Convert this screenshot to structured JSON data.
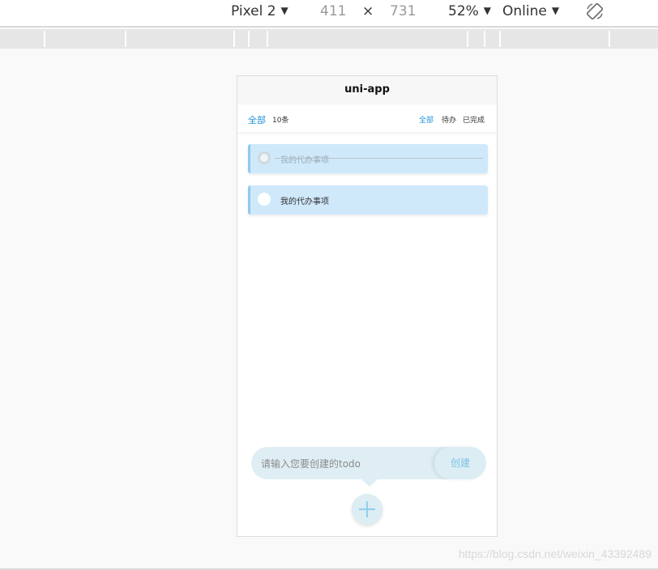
{
  "devtools": {
    "device": "Pixel 2",
    "width": "411",
    "times": "×",
    "height": "731",
    "zoom": "52%",
    "network": "Online",
    "caret": "▼"
  },
  "app": {
    "title": "uni-app",
    "filter": {
      "left_all": "全部",
      "count": "10条",
      "options": [
        "全部",
        "待办",
        "已完成"
      ],
      "active_index": 0
    },
    "todos": [
      {
        "text": "我的代办事项",
        "done": true
      },
      {
        "text": "我的代办事项",
        "done": false
      }
    ],
    "input": {
      "placeholder": "请输入您要创建的todo",
      "button_label": "创建"
    }
  },
  "watermark": "https://blog.csdn.net/weixin_43392489",
  "colors": {
    "accent": "#1f93d8",
    "todo_bg": "#cfe9fb",
    "input_bg": "#dfeef5"
  }
}
